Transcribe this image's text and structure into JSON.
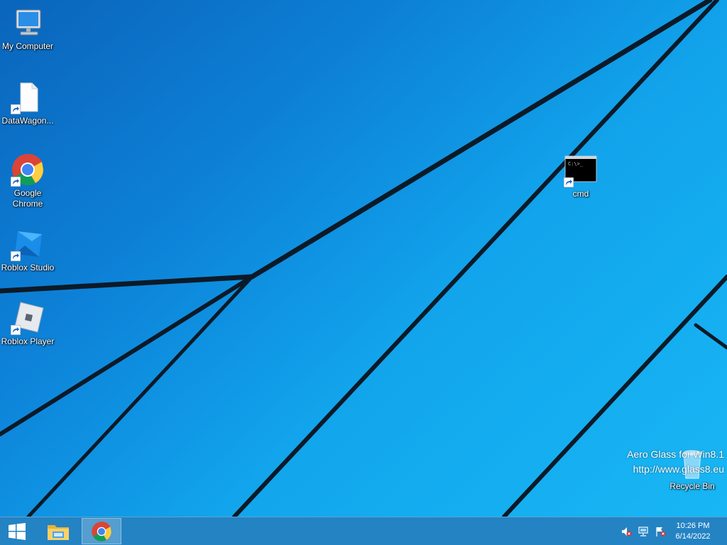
{
  "desktop": {
    "icons": [
      {
        "label": "My Computer",
        "icon": "computer-icon"
      },
      {
        "label": "DataWagon...",
        "icon": "blank-file-icon"
      },
      {
        "label": "Google Chrome",
        "icon": "chrome-icon"
      },
      {
        "label": "Roblox Studio",
        "icon": "roblox-studio-icon"
      },
      {
        "label": "Roblox Player",
        "icon": "roblox-player-icon"
      },
      {
        "label": "cmd",
        "icon": "cmd-icon"
      },
      {
        "label": "Recycle Bin",
        "icon": "recycle-bin-icon"
      }
    ],
    "watermark": {
      "line1": "Aero Glass for Win8.1",
      "line2": "http://www.glass8.eu"
    },
    "wallpaper_colors": [
      "#0a6ec8",
      "#18b6f4",
      "#0b1a28"
    ]
  },
  "taskbar": {
    "start_icon": "windows-logo-icon",
    "pinned": [
      {
        "icon": "file-explorer-icon",
        "active": false
      },
      {
        "icon": "chrome-icon",
        "active": true
      }
    ],
    "tray": [
      "speaker-muted-icon",
      "network-icon",
      "action-center-flag-icon"
    ],
    "clock": {
      "time": "10:26 PM",
      "date": "6/14/2022"
    },
    "background": "#1178be"
  }
}
